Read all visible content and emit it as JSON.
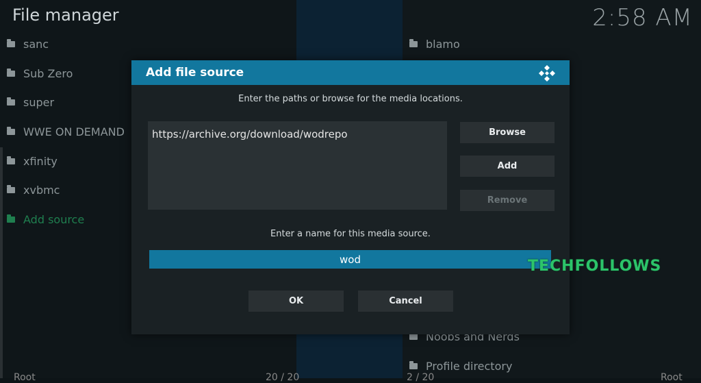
{
  "header": {
    "title": "File manager",
    "clock": "2:58 AM"
  },
  "left_list": [
    {
      "label": "sanc",
      "icon": "folder-icon"
    },
    {
      "label": "Sub Zero",
      "icon": "folder-icon"
    },
    {
      "label": "super",
      "icon": "folder-icon"
    },
    {
      "label": "WWE ON DEMAND",
      "icon": "folder-icon"
    },
    {
      "label": "xfinity",
      "icon": "folder-icon"
    },
    {
      "label": "xvbmc",
      "icon": "folder-icon"
    },
    {
      "label": "Add source",
      "icon": "folder-icon"
    }
  ],
  "right_list": [
    {
      "label": "blamo",
      "icon": "folder-icon"
    },
    {
      "label": "Noobs and Nerds",
      "icon": "folder-icon"
    },
    {
      "label": "Profile directory",
      "icon": "folder-icon"
    }
  ],
  "footer": {
    "left": "Root",
    "count_left": "20 / 20",
    "count_right": "2 / 20",
    "right": "Root"
  },
  "dialog": {
    "title": "Add file source",
    "logo_icon": "kodi-logo-icon",
    "path_instruction": "Enter the paths or browse for the media locations.",
    "path_value": "https://archive.org/download/wodrepo",
    "browse_label": "Browse",
    "add_label": "Add",
    "remove_label": "Remove",
    "name_instruction": "Enter a name for this media source.",
    "name_value": "wod",
    "ok_label": "OK",
    "cancel_label": "Cancel"
  },
  "watermark": "TECHFOLLOWS",
  "colors": {
    "accent": "#12779e",
    "add_source_green": "#1f7f4f",
    "watermark_green": "#2cc46a"
  }
}
